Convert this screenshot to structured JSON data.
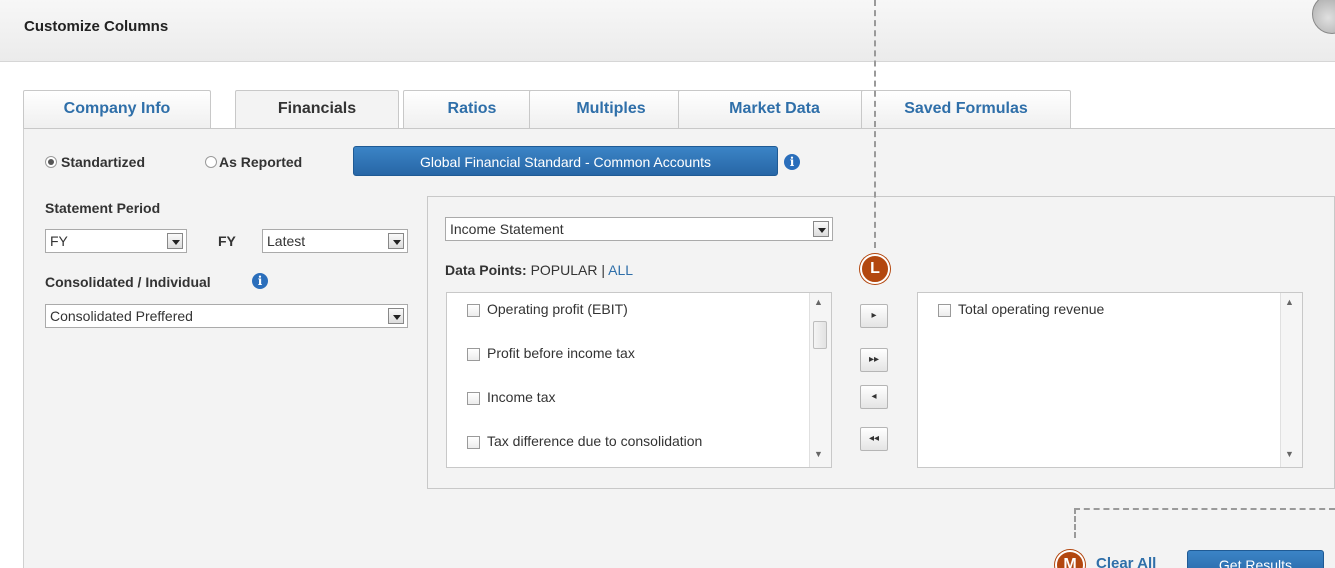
{
  "dialog": {
    "title": "Customize Columns"
  },
  "tabs": [
    {
      "label": "Company Info",
      "active": false
    },
    {
      "label": "Financials",
      "active": true
    },
    {
      "label": "Ratios",
      "active": false
    },
    {
      "label": "Multiples",
      "active": false
    },
    {
      "label": "Market Data",
      "active": false
    },
    {
      "label": "Saved Formulas",
      "active": false
    }
  ],
  "accounting": {
    "standardized_label": "Standartized",
    "as_reported_label": "As Reported",
    "selected": "Standartized",
    "standard_button_label": "Global Financial Standard - Common Accounts",
    "info_glyph": "i"
  },
  "statement_period": {
    "label": "Statement Period",
    "period_value": "FY",
    "fy_label": "FY",
    "fy_value": "Latest"
  },
  "consolidation": {
    "label": "Consolidated / Individual",
    "value": "Consolidated Preffered",
    "info_glyph": "i"
  },
  "statement_select": {
    "value": "Income Statement"
  },
  "data_points": {
    "label": "Data Points:",
    "popular_label": "POPULAR",
    "separator": "|",
    "all_label": "ALL",
    "available": [
      {
        "label": "Operating profit (EBIT)",
        "checked": false
      },
      {
        "label": "Profit before income tax",
        "checked": false
      },
      {
        "label": "Income tax",
        "checked": false
      },
      {
        "label": "Tax difference due to consolidation",
        "checked": false
      }
    ],
    "selected": [
      {
        "label": "Total operating revenue",
        "checked": false
      }
    ]
  },
  "move_buttons": {
    "add_one": "▸",
    "add_all": "▸▸",
    "remove_one": "◂",
    "remove_all": "◂◂"
  },
  "markers": {
    "l": "L",
    "m": "M"
  },
  "footer": {
    "clear_all_label": "Clear All",
    "get_results_label": "Get Results"
  },
  "colors": {
    "link_blue": "#2f6fa9",
    "button_blue": "#2766a6",
    "marker_orange": "#b3470f",
    "panel_gray": "#f3f3f3"
  }
}
